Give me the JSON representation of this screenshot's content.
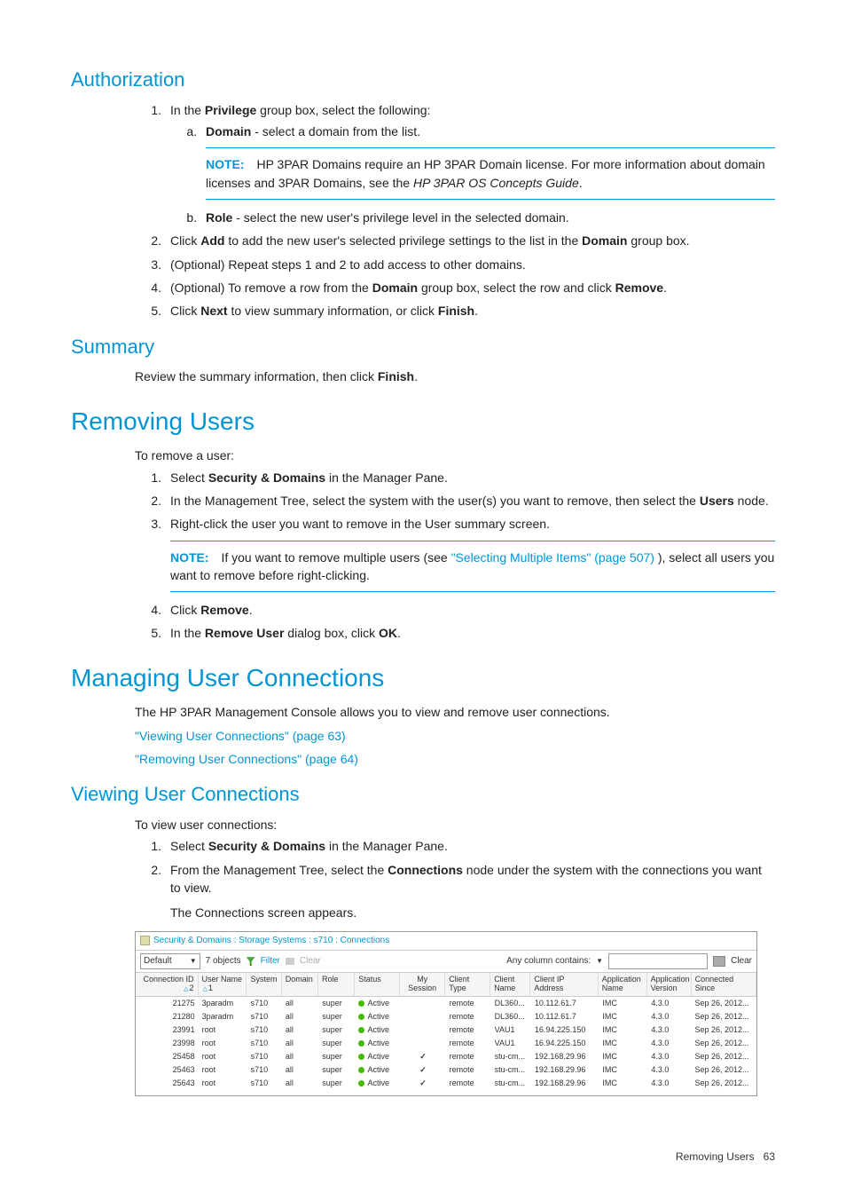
{
  "sections": {
    "authorization_title": "Authorization",
    "auth_step1_intro": "In the ",
    "auth_step1_bold": "Privilege",
    "auth_step1_rest": " group box, select the following:",
    "auth_a_bold": "Domain",
    "auth_a_rest": " - select a domain from the list.",
    "note1_label": "NOTE:",
    "note1_body1": "HP 3PAR Domains require an HP 3PAR Domain license. For more information about domain licenses and 3PAR Domains, see the ",
    "note1_italic": "HP 3PAR OS Concepts Guide",
    "note1_body2": ".",
    "auth_b_bold": "Role",
    "auth_b_rest": " - select the new user's privilege level in the selected domain.",
    "auth_step2_a": "Click ",
    "auth_step2_b1": "Add",
    "auth_step2_c": " to add the new user's selected privilege settings to the list in the ",
    "auth_step2_b2": "Domain",
    "auth_step2_d": " group box.",
    "auth_step3": "(Optional) Repeat steps 1 and 2 to add access to other domains.",
    "auth_step4_a": "(Optional) To remove a row from the ",
    "auth_step4_b1": "Domain",
    "auth_step4_b": " group box, select the row and click ",
    "auth_step4_b2": "Remove",
    "auth_step4_c": ".",
    "auth_step5_a": "Click ",
    "auth_step5_b1": "Next",
    "auth_step5_b": " to view summary information, or click ",
    "auth_step5_b2": "Finish",
    "auth_step5_c": ".",
    "summary_title": "Summary",
    "summary_body_a": "Review the summary information, then click ",
    "summary_body_b": "Finish",
    "summary_body_c": ".",
    "removing_title": "Removing Users",
    "removing_intro": "To remove a user:",
    "rem_step1_a": "Select ",
    "rem_step1_b": "Security & Domains",
    "rem_step1_c": " in the Manager Pane.",
    "rem_step2_a": "In the Management Tree, select the system with the user(s) you want to remove, then select the ",
    "rem_step2_b": "Users",
    "rem_step2_c": " node.",
    "rem_step3": "Right-click the user you want to remove in the User summary screen.",
    "note2_label": "NOTE:",
    "note2_body1": "If you want to remove multiple users (see ",
    "note2_link": "\"Selecting Multiple Items\" (page 507)",
    "note2_body2": " ), select all users you want to remove before right-clicking.",
    "rem_step4_a": "Click ",
    "rem_step4_b": "Remove",
    "rem_step4_c": ".",
    "rem_step5_a": "In the ",
    "rem_step5_b1": "Remove User",
    "rem_step5_b": " dialog box, click ",
    "rem_step5_b2": "OK",
    "rem_step5_c": ".",
    "managing_title": "Managing User Connections",
    "managing_intro": "The HP 3PAR Management Console allows you to view and remove user connections.",
    "managing_link1": "\"Viewing User Connections\" (page 63)",
    "managing_link2": "\"Removing User Connections\" (page 64)",
    "viewing_title": "Viewing User Connections",
    "viewing_intro": "To view user connections:",
    "view_step1_a": "Select ",
    "view_step1_b": "Security & Domains",
    "view_step1_c": " in the Manager Pane.",
    "view_step2_a": "From the Management Tree, select the ",
    "view_step2_b": "Connections",
    "view_step2_c": " node under the system with the connections you want to view.",
    "view_after": "The Connections screen appears."
  },
  "screenshot": {
    "breadcrumb": "Security & Domains : Storage Systems : s710 : Connections",
    "group_dropdown": "Default",
    "object_count": "7 objects",
    "filter_label": "Filter",
    "clear_label": "Clear",
    "any_column": "Any column contains:",
    "clear_btn": "Clear",
    "headers": {
      "conn": "Connection ID",
      "conn_sort": "2",
      "user": "User Name",
      "user_sort": "1",
      "system": "System",
      "domain": "Domain",
      "role": "Role",
      "status": "Status",
      "mysession": "My Session",
      "ctype": "Client Type",
      "cname": "Client Name",
      "cip": "Client IP Address",
      "app": "Application Name",
      "ver": "Application Version",
      "since": "Connected Since"
    },
    "rows": [
      {
        "conn": "21275",
        "user": "3paradm",
        "sys": "s710",
        "dom": "all",
        "role": "super",
        "stat": "Active",
        "mys": "",
        "ctype": "remote",
        "cname": "DL360...",
        "cip": "10.112.61.7",
        "app": "IMC",
        "ver": "4.3.0",
        "since": "Sep 26, 2012..."
      },
      {
        "conn": "21280",
        "user": "3paradm",
        "sys": "s710",
        "dom": "all",
        "role": "super",
        "stat": "Active",
        "mys": "",
        "ctype": "remote",
        "cname": "DL360...",
        "cip": "10.112.61.7",
        "app": "IMC",
        "ver": "4.3.0",
        "since": "Sep 26, 2012..."
      },
      {
        "conn": "23991",
        "user": "root",
        "sys": "s710",
        "dom": "all",
        "role": "super",
        "stat": "Active",
        "mys": "",
        "ctype": "remote",
        "cname": "VAU1",
        "cip": "16.94.225.150",
        "app": "IMC",
        "ver": "4.3.0",
        "since": "Sep 26, 2012..."
      },
      {
        "conn": "23998",
        "user": "root",
        "sys": "s710",
        "dom": "all",
        "role": "super",
        "stat": "Active",
        "mys": "",
        "ctype": "remote",
        "cname": "VAU1",
        "cip": "16.94.225.150",
        "app": "IMC",
        "ver": "4.3.0",
        "since": "Sep 26, 2012..."
      },
      {
        "conn": "25458",
        "user": "root",
        "sys": "s710",
        "dom": "all",
        "role": "super",
        "stat": "Active",
        "mys": "✓",
        "ctype": "remote",
        "cname": "stu-cm...",
        "cip": "192.168.29.96",
        "app": "IMC",
        "ver": "4.3.0",
        "since": "Sep 26, 2012..."
      },
      {
        "conn": "25463",
        "user": "root",
        "sys": "s710",
        "dom": "all",
        "role": "super",
        "stat": "Active",
        "mys": "✓",
        "ctype": "remote",
        "cname": "stu-cm...",
        "cip": "192.168.29.96",
        "app": "IMC",
        "ver": "4.3.0",
        "since": "Sep 26, 2012..."
      },
      {
        "conn": "25643",
        "user": "root",
        "sys": "s710",
        "dom": "all",
        "role": "super",
        "stat": "Active",
        "mys": "✓",
        "ctype": "remote",
        "cname": "stu-cm...",
        "cip": "192.168.29.96",
        "app": "IMC",
        "ver": "4.3.0",
        "since": "Sep 26, 2012..."
      }
    ]
  },
  "footer": {
    "text": "Removing Users",
    "page": "63"
  }
}
